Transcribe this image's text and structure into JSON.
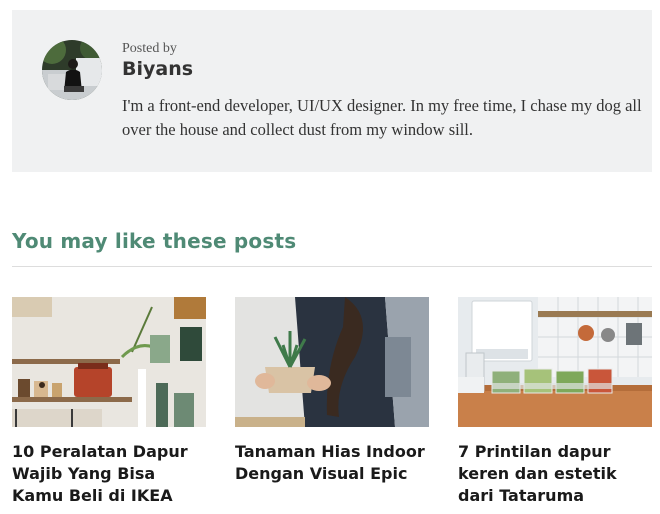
{
  "author": {
    "posted_by": "Posted by",
    "name": "Biyans",
    "bio": "I'm a front-end developer, UI/UX designer. In my free time, I chase my dog all over the house and collect dust from my window sill."
  },
  "related": {
    "heading": "You may like these posts",
    "posts": [
      {
        "title": "10 Peralatan Dapur Wajib Yang Bisa Kamu Beli di IKEA"
      },
      {
        "title": "Tanaman Hias Indoor Dengan Visual Epic"
      },
      {
        "title": "7 Printilan dapur keren dan estetik dari Tataruma"
      }
    ]
  },
  "colors": {
    "accent": "#4f8a75",
    "author_box_bg": "#f0f1f2"
  }
}
